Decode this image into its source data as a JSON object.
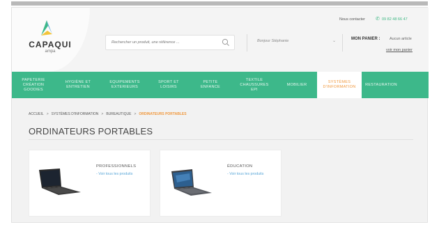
{
  "header": {
    "logo": {
      "name": "CAPAQUI",
      "sub": "ampa"
    },
    "search": {
      "placeholder": "Rechercher un produit, une référence ..."
    },
    "greeting": "Bonjour Stéphanie",
    "contact": {
      "label": "Nous contacter",
      "phone": "09 82 48 66 47"
    },
    "cart": {
      "title": "MON PANIER :",
      "status": "Aucun article",
      "link": "voir mon panier"
    }
  },
  "nav": {
    "items": [
      {
        "label": "PAPETERIE\nCRÉATION\nGOODIES"
      },
      {
        "label": "HYGIÈNE ET\nENTRETIEN"
      },
      {
        "label": "EQUIPEMENTS\nEXTERIEURS"
      },
      {
        "label": "SPORT ET\nLOISIRS"
      },
      {
        "label": "PETITE\nENFANCE"
      },
      {
        "label": "TEXTILE\nCHAUSSURES\nEPI"
      },
      {
        "label": "MOBILIER"
      },
      {
        "label": "SYSTÈMES\nD'INFORMATION"
      },
      {
        "label": "RESTAURATION"
      }
    ]
  },
  "breadcrumb": {
    "items": [
      "ACCUEIL",
      "SYSTÈMES D'INFORMATION",
      "BUREAUTIQUE",
      "ORDINATEURS PORTABLES"
    ],
    "separator": ">"
  },
  "page": {
    "title": "ORDINATEURS PORTABLES"
  },
  "categories": [
    {
      "title": "PROFESSIONNELS",
      "link": "- Voir tous les produits"
    },
    {
      "title": "ÉDUCATION",
      "link": "- Voir tous les produits"
    }
  ],
  "colors": {
    "brand_green": "#3db88a",
    "accent_orange": "#f0963a",
    "link_blue": "#5aa7d8"
  }
}
